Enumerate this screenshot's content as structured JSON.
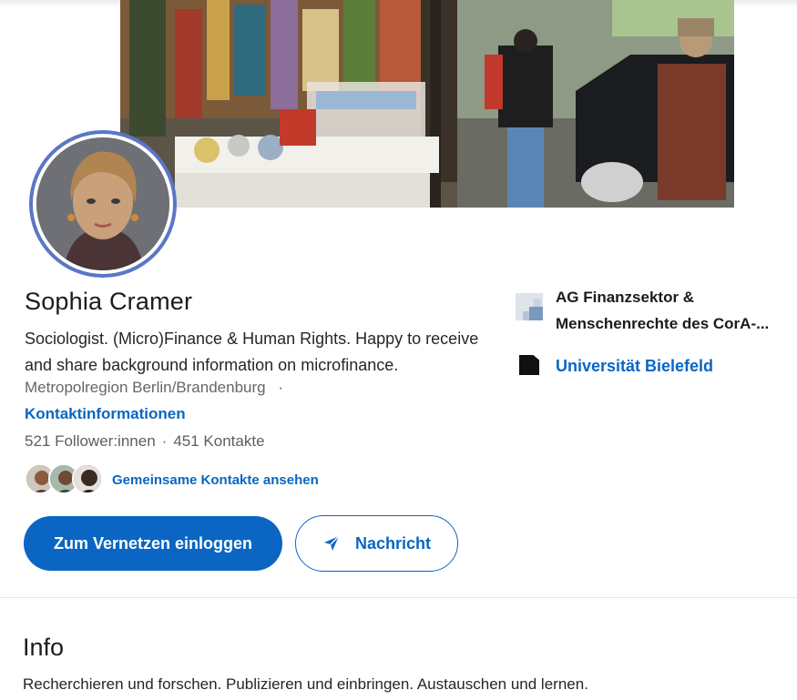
{
  "profile": {
    "name": "Sophia Cramer",
    "headline": "Sociologist. (Micro)Finance & Human Rights. Happy to receive and share background information on microfinance.",
    "location": "Metropolregion Berlin/Brandenburg",
    "location_separator": "·",
    "contact_link": "Kontaktinformationen",
    "followers": "521 Follower:innen",
    "stats_separator": "·",
    "connections": "451 Kontakte",
    "mutual_link": "Gemeinsame Kontakte ansehen"
  },
  "actions": {
    "connect_label": "Zum Vernetzen einloggen",
    "message_label": "Nachricht",
    "message_icon": "send-icon"
  },
  "experience": {
    "items": [
      {
        "label_line1": "AG Finanzsektor &",
        "label_line2": "Menschenrechte des CorA-...",
        "logo": "organization-logo"
      },
      {
        "label": "Universität Bielefeld",
        "logo": "university-logo"
      }
    ]
  },
  "info": {
    "title": "Info",
    "text": "Recherchieren und forschen. Publizieren und einbringen. Austauschen und lernen."
  },
  "colors": {
    "brand_blue": "#0a66c2",
    "avatar_ring": "#5a76c6"
  }
}
